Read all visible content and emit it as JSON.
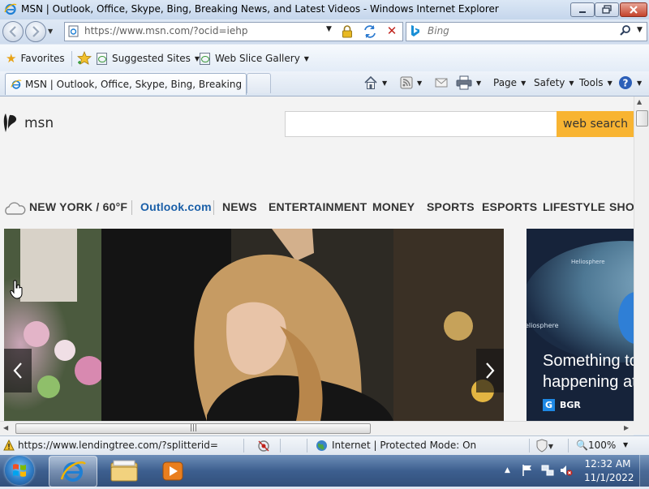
{
  "window": {
    "title": "MSN | Outlook, Office, Skype, Bing, Breaking News, and Latest Videos - Windows Internet Explorer"
  },
  "address": {
    "url": "https://www.msn.com/?ocid=iehp"
  },
  "search": {
    "placeholder": "Bing"
  },
  "favorites_bar": {
    "favorites_label": "Favorites",
    "suggested_label": "Suggested Sites",
    "webslice_label": "Web Slice Gallery"
  },
  "tab": {
    "label": "MSN | Outlook, Office, Skype, Bing, Breaking Ne..."
  },
  "command_bar": {
    "page_label": "Page",
    "safety_label": "Safety",
    "tools_label": "Tools"
  },
  "page": {
    "logo_text": "msn",
    "search_button": "web search",
    "nav": {
      "weather": "NEW YORK / 60°F",
      "outlook": "Outlook.com",
      "news": "NEWS",
      "entertainment": "ENTERTAINMENT",
      "money": "MONEY",
      "sports": "SPORTS",
      "esports": "ESPORTS",
      "lifestyle": "LIFESTYLE",
      "shop": "SHO"
    },
    "side_card": {
      "headline": "Something to\nhappening at",
      "source": "BGR",
      "overlay_text_1": "Heliosphere",
      "overlay_text_2": "eliosphere"
    }
  },
  "status_bar": {
    "url": "https://www.lendingtree.com/?splitterid=",
    "zone": "Internet | Protected Mode: On",
    "zoom": "100%"
  },
  "taskbar": {
    "time": "12:32 AM",
    "date": "11/1/2022"
  },
  "colors": {
    "search_button": "#f8b432",
    "outlook_link": "#1a5fa8",
    "taskbar": "#3d5f8f"
  }
}
